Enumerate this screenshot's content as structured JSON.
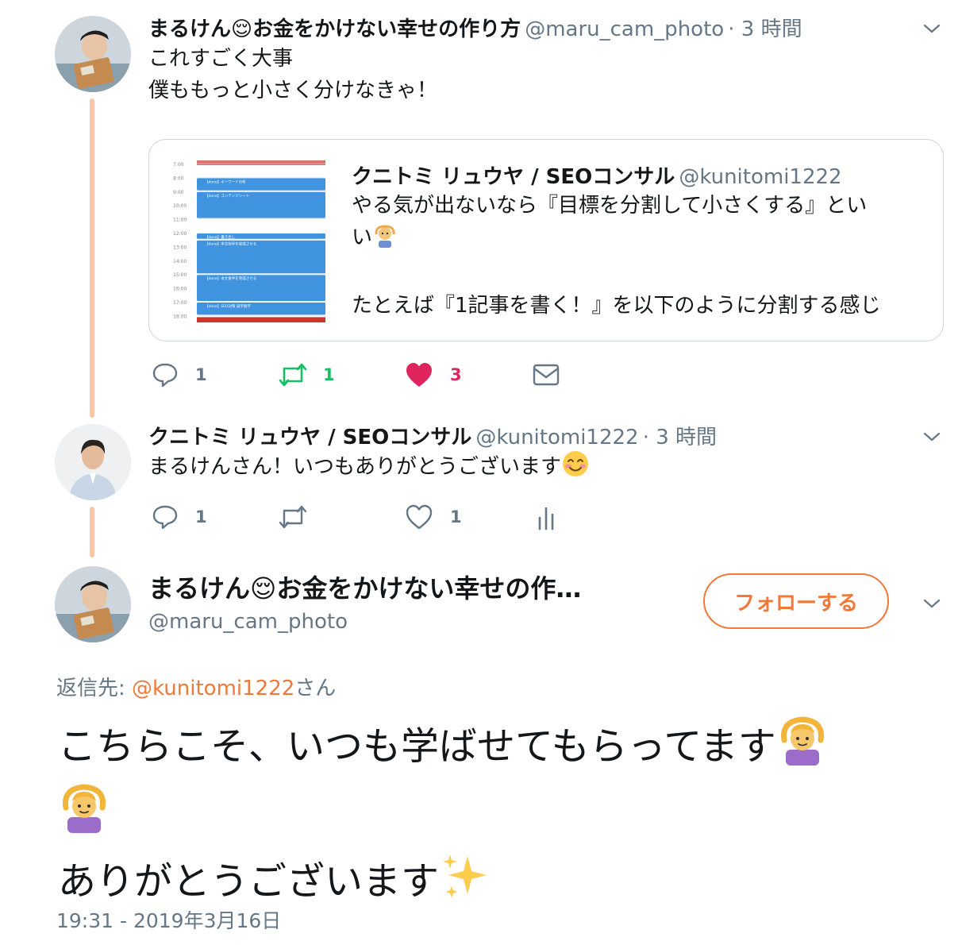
{
  "colors": {
    "accent": "#f0793a",
    "retweet_green": "#17bf63",
    "like_red": "#e0245e",
    "muted": "#657786"
  },
  "tweet1": {
    "name": "まるけん😌お金をかけない幸せの作り方",
    "handle": "@maru_cam_photo",
    "time": "· 3 時間",
    "lines": [
      "これすごく大事",
      "僕ももっと小さく分けなきゃ！"
    ],
    "actions": {
      "reply": "1",
      "retweet": "1",
      "like": "3"
    },
    "quote": {
      "name": "クニトミ リュウヤ / SEOコンサル",
      "handle": "@kunitomi1222",
      "text_line1": "やる気が出ないなら『目標を分割して小さくする』とい",
      "text_line2": "い",
      "text_line3": "たとえば『1記事を書く！』を以下のように分割する感じ",
      "calendar": {
        "hours": [
          "7:00",
          "8:00",
          "9:00",
          "10:00",
          "11:00",
          "12:00",
          "13:00",
          "14:00",
          "15:00",
          "16:00",
          "17:00",
          "18:00"
        ],
        "events": [
          "【done】キーワード分析",
          "【done】コンテンツシート",
          "【done】書き出し",
          "【done】本文前半を完成させる",
          "【done】本文後半を完成させる",
          "【done】SEO対策 誤字脱字"
        ]
      }
    }
  },
  "tweet2": {
    "name": "クニトミ リュウヤ / SEOコンサル",
    "handle": "@kunitomi1222",
    "time": "· 3 時間",
    "text": "まるけんさん！いつもありがとうございます",
    "actions": {
      "reply": "1",
      "like": "1"
    }
  },
  "main": {
    "name": "まるけん😌お金をかけない幸せの作…",
    "handle": "@maru_cam_photo",
    "follow_label": "フォローする",
    "reply_prefix": "返信先: ",
    "reply_to": "@kunitomi1222",
    "reply_suffix": "さん",
    "text_line1": "こちらこそ、いつも学ばせてもらってます",
    "text_line3": "ありがとうございます",
    "timestamp": "19:31 - 2019年3月16日"
  }
}
